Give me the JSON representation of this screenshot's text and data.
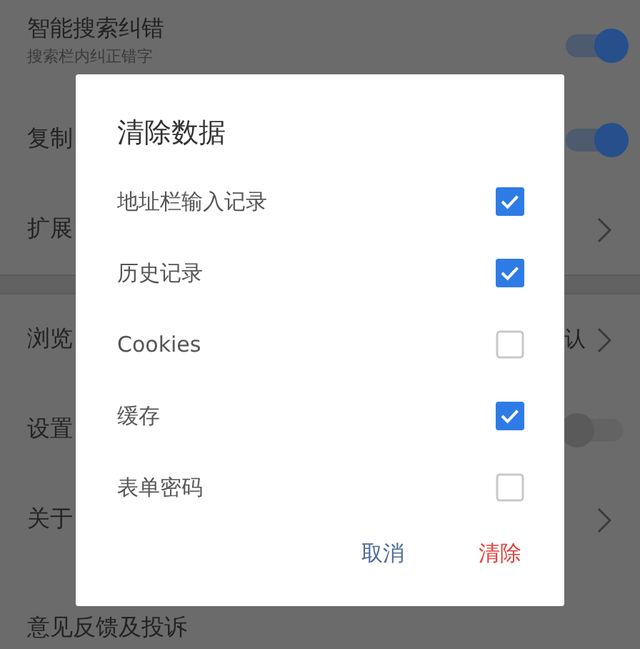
{
  "settings": [
    {
      "kind": "toggle",
      "label": "智能搜索纠错",
      "subtitle": "搜索栏内纠正错字",
      "on": true
    },
    {
      "kind": "toggle",
      "label": "复制",
      "on": true
    },
    {
      "kind": "link",
      "label": "扩展"
    },
    {
      "kind": "divider"
    },
    {
      "kind": "link",
      "label": "浏览",
      "value": "认"
    },
    {
      "kind": "toggle",
      "label": "设置",
      "on": false
    },
    {
      "kind": "link",
      "label": "关于"
    },
    {
      "kind": "plain",
      "label": "意见反馈及投诉"
    }
  ],
  "dialog": {
    "title": "清除数据",
    "options": [
      {
        "label": "地址栏输入记录",
        "checked": true
      },
      {
        "label": "历史记录",
        "checked": true
      },
      {
        "label": "Cookies",
        "checked": false
      },
      {
        "label": "缓存",
        "checked": true
      },
      {
        "label": "表单密码",
        "checked": false
      }
    ],
    "buttons": [
      {
        "kind": "cancel",
        "label": "取消"
      },
      {
        "kind": "confirm",
        "label": "清除"
      }
    ]
  }
}
